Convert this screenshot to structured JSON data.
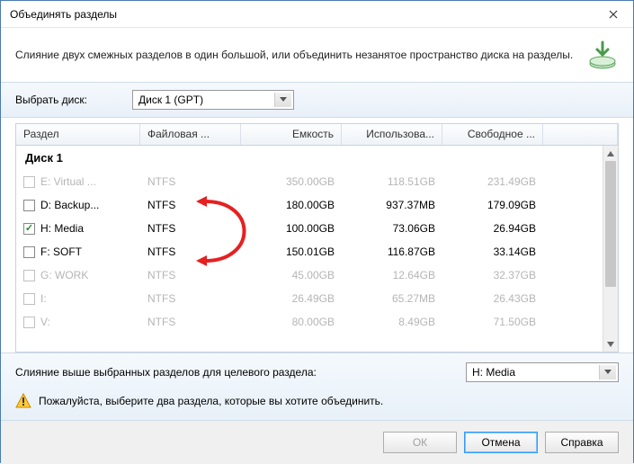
{
  "title": "Объединять разделы",
  "description": "Слияние двух смежных разделов в один большой, или объединить незанятое пространство диска на разделы.",
  "disk_selector": {
    "label": "Выбрать диск:",
    "value": "Диск 1 (GPT)"
  },
  "columns": {
    "partition": "Раздел",
    "filesystem": "Файловая ...",
    "capacity": "Емкость",
    "used": "Использова...",
    "free": "Свободное ..."
  },
  "group_label": "Диск 1",
  "rows": [
    {
      "label": "E: Virtual ...",
      "fs": "NTFS",
      "cap": "350.00GB",
      "used": "118.51GB",
      "free": "231.49GB",
      "checked": false,
      "enabled": false
    },
    {
      "label": "D: Backup...",
      "fs": "NTFS",
      "cap": "180.00GB",
      "used": "937.37MB",
      "free": "179.09GB",
      "checked": false,
      "enabled": true
    },
    {
      "label": "H: Media",
      "fs": "NTFS",
      "cap": "100.00GB",
      "used": "73.06GB",
      "free": "26.94GB",
      "checked": true,
      "enabled": true
    },
    {
      "label": "F: SOFT",
      "fs": "NTFS",
      "cap": "150.01GB",
      "used": "116.87GB",
      "free": "33.14GB",
      "checked": false,
      "enabled": true
    },
    {
      "label": "G: WORK",
      "fs": "NTFS",
      "cap": "45.00GB",
      "used": "12.64GB",
      "free": "32.37GB",
      "checked": false,
      "enabled": false
    },
    {
      "label": "I:",
      "fs": "NTFS",
      "cap": "26.49GB",
      "used": "65.27MB",
      "free": "26.43GB",
      "checked": false,
      "enabled": false
    },
    {
      "label": "V:",
      "fs": "NTFS",
      "cap": "80.00GB",
      "used": "8.49GB",
      "free": "71.50GB",
      "checked": false,
      "enabled": false
    }
  ],
  "target": {
    "label": "Слияние выше выбранных разделов для целевого раздела:",
    "value": "H: Media"
  },
  "warning": "Пожалуйста, выберите два раздела, которые вы хотите объединить.",
  "buttons": {
    "ok": "ОК",
    "cancel": "Отмена",
    "help": "Справка"
  }
}
